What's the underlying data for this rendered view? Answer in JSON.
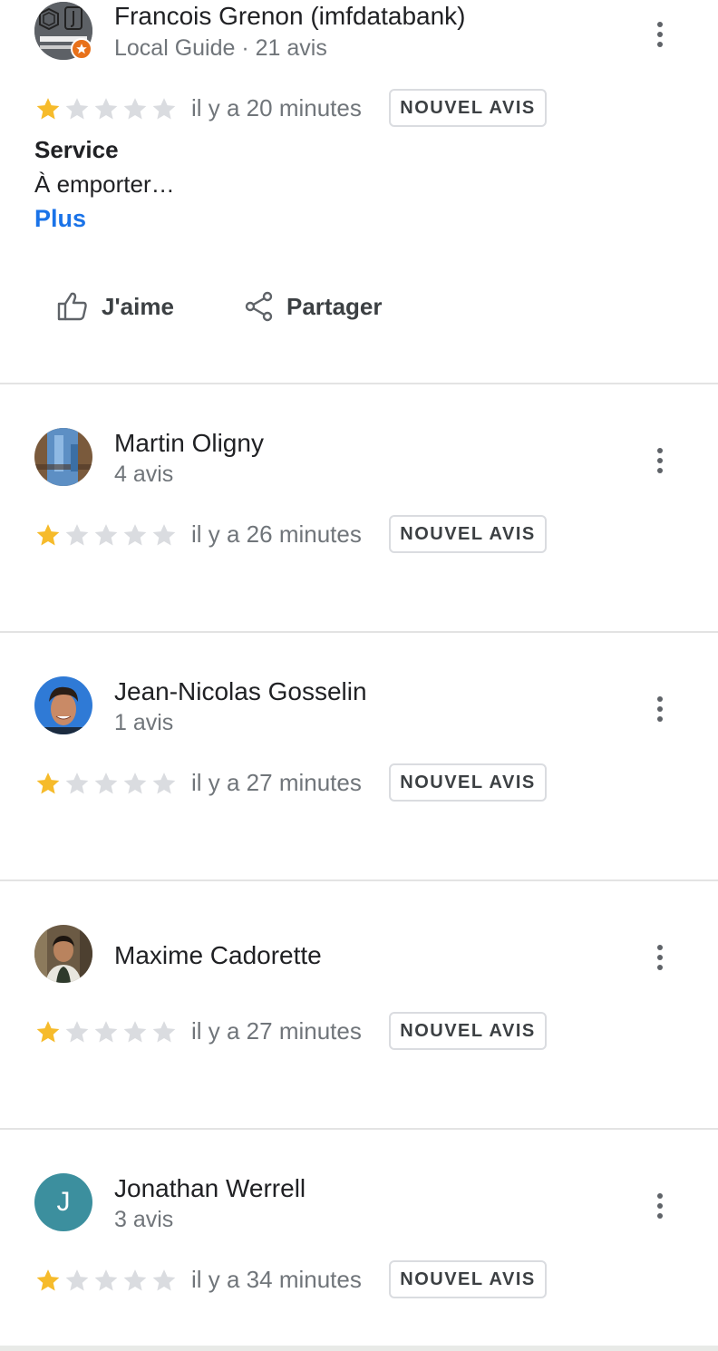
{
  "reviews": [
    {
      "author": "Francois Grenon (imfdatabank)",
      "meta": "Local Guide · 21 avis",
      "rating": 1,
      "time": "il y a 20 minutes",
      "badge": "NOUVEL AVIS",
      "service_title": "Service",
      "service_text": "À emporter…",
      "more": "Plus",
      "like": "J'aime",
      "share": "Partager"
    },
    {
      "author": "Martin Oligny",
      "meta": "4 avis",
      "rating": 1,
      "time": "il y a 26 minutes",
      "badge": "NOUVEL AVIS"
    },
    {
      "author": "Jean-Nicolas Gosselin",
      "meta": "1 avis",
      "rating": 1,
      "time": "il y a 27 minutes",
      "badge": "NOUVEL AVIS"
    },
    {
      "author": "Maxime Cadorette",
      "rating": 1,
      "time": "il y a 27 minutes",
      "badge": "NOUVEL AVIS"
    },
    {
      "author": "Jonathan Werrell",
      "meta": "3 avis",
      "rating": 1,
      "time": "il y a 34 minutes",
      "badge": "NOUVEL AVIS",
      "avatar_letter": "J"
    }
  ],
  "colors": {
    "star_filled": "#f6bb2b",
    "star_empty": "#dadce0",
    "link": "#1a73e8",
    "avatar_letter_bg": "#3c8f9e"
  },
  "icons": {
    "like": "thumb-up-icon",
    "share": "share-icon",
    "more": "more-vert-icon",
    "star": "star-icon"
  }
}
